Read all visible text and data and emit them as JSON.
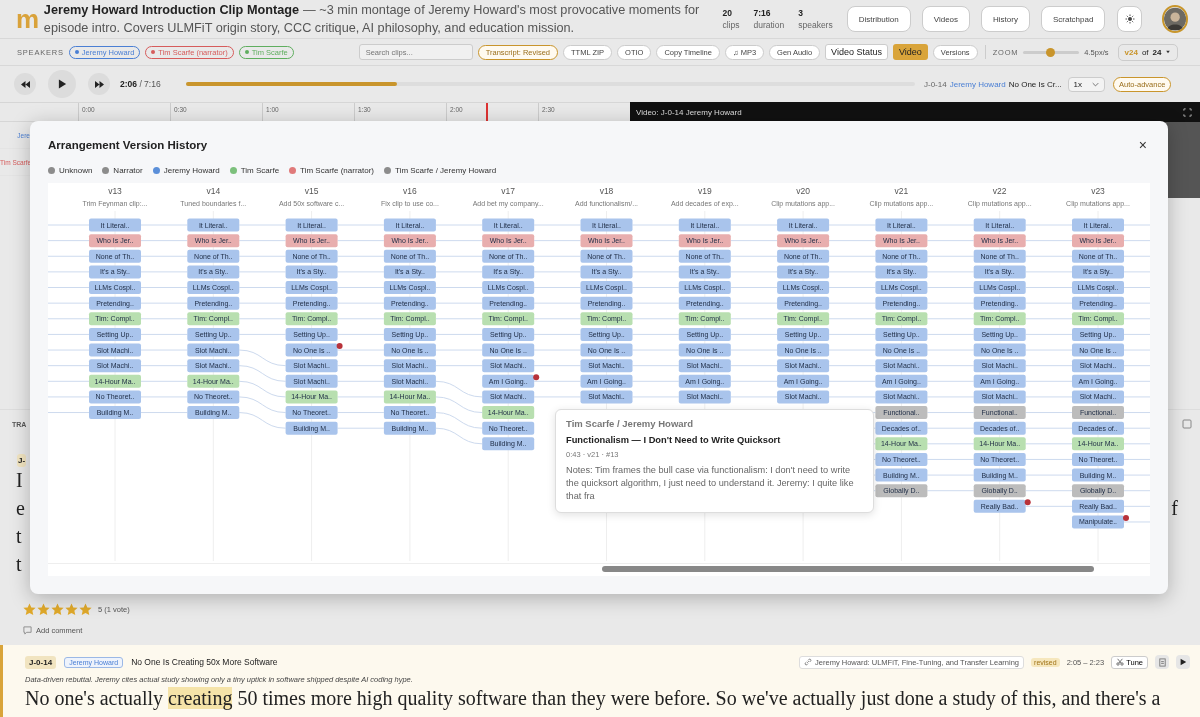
{
  "header": {
    "logo": "m",
    "title": "Jeremy Howard Introduction Clip Montage",
    "description": "— ~3 min montage of Jeremy Howard's most provocative moments for episode intro. Covers ULMFiT origin story, CCC critique, AI philosophy, and education mission.",
    "stats": [
      {
        "value": "20",
        "label": "clips"
      },
      {
        "value": "7:16",
        "label": "duration"
      },
      {
        "value": "3",
        "label": "speakers"
      }
    ],
    "buttons": [
      "Distribution",
      "Videos",
      "History",
      "Scratchpad"
    ]
  },
  "toolbar": {
    "speakers_label": "SPEAKERS",
    "speakers": [
      {
        "name": "Jeremy Howard",
        "color": "#4a7fd4"
      },
      {
        "name": "Tim Scarfe (narrator)",
        "color": "#d65c5c"
      },
      {
        "name": "Tim Scarfe",
        "color": "#5fae5f"
      }
    ],
    "search": {
      "placeholder": "Search clips..."
    },
    "actions": [
      {
        "label": "Transcript: Revised",
        "kind": "status"
      },
      {
        "label": "TTML ZIP",
        "kind": "pill"
      },
      {
        "label": "OTIO",
        "kind": "pill"
      },
      {
        "label": "Copy Timeline",
        "kind": "pill"
      },
      {
        "label": "♫ MP3",
        "kind": "pill"
      },
      {
        "label": "Gen Audio",
        "kind": "pill"
      },
      {
        "label": "Video Status",
        "kind": "box"
      },
      {
        "label": "Video",
        "kind": "toggle",
        "on": true
      },
      {
        "label": "Versions",
        "kind": "pill"
      }
    ],
    "zoom": {
      "label": "ZOOM",
      "level": 0.48,
      "reading": "4.5px/s"
    },
    "version_select": {
      "current": "v24",
      "of": "of",
      "total": "24"
    }
  },
  "player": {
    "elapsed": "2:06",
    "total": "/ 7:16",
    "progress": {
      "level": 0.29
    },
    "clip_id": "J-0-14",
    "speaker": "Jeremy Howard",
    "clip_title": "No One Is Cr...",
    "speed": "1x",
    "auto_advance": "Auto-advance"
  },
  "timeline": {
    "ticks": [
      "0:00",
      "0:30",
      "1:00",
      "1:30",
      "2:00",
      "2:30"
    ],
    "lanes": [
      {
        "label": "Jere",
        "kind": "jeremy"
      },
      {
        "label": "Tim Scarfe",
        "kind": "narrator"
      }
    ]
  },
  "video": {
    "title": "Video: J-0-14 Jeremy Howard"
  },
  "transcript": {
    "section_label": "TRA",
    "badge": "J-",
    "lines": [
      {
        "start": "I"
      },
      {
        "start": "e",
        "end": "f"
      },
      {
        "start": "t"
      },
      {
        "start": "t"
      }
    ]
  },
  "rating": {
    "stars": 5,
    "count": "5 (1 vote)"
  },
  "add_comment": "Add comment",
  "clip_card": {
    "id": "J-0-14",
    "speaker": "Jeremy Howard",
    "title": "No One Is Creating 50x More Software",
    "source": "Jeremy Howard: ULMFiT, Fine-Tuning, and Transfer Learning",
    "status": "revised",
    "range": "2:05 – 2:23",
    "tune": "Tune",
    "note": "Data-driven rebuttal. Jeremy cites actual study showing only a tiny uptick in software shipped despite AI coding hype.",
    "text": [
      {
        "text": "No one's actually ",
        "highlighted": false
      },
      {
        "text": "creating",
        "highlighted": true
      },
      {
        "text": " 50 times more high quality software than they were before. So we've actually just done a study of this, and there's a",
        "highlighted": false
      }
    ]
  },
  "modal": {
    "title": "Arrangement Version History",
    "close": "×",
    "legend": [
      {
        "label": "Unknown",
        "color": "#8c8c8c"
      },
      {
        "label": "Narrator",
        "color": "#8c8c8c"
      },
      {
        "label": "Jeremy Howard",
        "color": "#5b8fd9"
      },
      {
        "label": "Tim Scarfe",
        "color": "#7cc07c"
      },
      {
        "label": "Tim Scarfe (narrator)",
        "color": "#e07a7a"
      },
      {
        "label": "Tim Scarfe / Jeremy Howard",
        "color": "#8c8c8c"
      }
    ],
    "columns": [
      {
        "version": "v13",
        "summary": "Trim Feynman clip:...",
        "clips": [
          {
            "label": "It Literal..",
            "color": "#a9c4ec",
            "added": false
          },
          {
            "label": "Who Is Jer..",
            "color": "#e8aeae",
            "added": false
          },
          {
            "label": "None of Th..",
            "color": "#a9c4ec",
            "added": false
          },
          {
            "label": "It's a Sty..",
            "color": "#a9c4ec",
            "added": false
          },
          {
            "label": "LLMs Cospl..",
            "color": "#a9c4ec",
            "added": false
          },
          {
            "label": "Pretending..",
            "color": "#a9c4ec",
            "added": false
          },
          {
            "label": "Tim: Compl..",
            "color": "#b8dfb0",
            "added": false
          },
          {
            "label": "Setting Up..",
            "color": "#a9c4ec",
            "added": false
          },
          {
            "label": "Slot Machi..",
            "color": "#a9c4ec",
            "added": false
          },
          {
            "label": "Slot Machi..",
            "color": "#a9c4ec",
            "added": false
          },
          {
            "label": "14-Hour Ma..",
            "color": "#b8dfb0",
            "added": false
          },
          {
            "label": "No Theoret..",
            "color": "#a9c4ec",
            "added": false
          },
          {
            "label": "Building M..",
            "color": "#a9c4ec",
            "added": false
          }
        ]
      },
      {
        "version": "v14",
        "summary": "Tuned boundaries f...",
        "clips": [
          {
            "label": "It Literal..",
            "color": "#a9c4ec",
            "added": false
          },
          {
            "label": "Who Is Jer..",
            "color": "#e8aeae",
            "added": false
          },
          {
            "label": "None of Th..",
            "color": "#a9c4ec",
            "added": false
          },
          {
            "label": "It's a Sty..",
            "color": "#a9c4ec",
            "added": false
          },
          {
            "label": "LLMs Cospl..",
            "color": "#a9c4ec",
            "added": false
          },
          {
            "label": "Pretending..",
            "color": "#a9c4ec",
            "added": false
          },
          {
            "label": "Tim: Compl..",
            "color": "#b8dfb0",
            "added": false
          },
          {
            "label": "Setting Up..",
            "color": "#a9c4ec",
            "added": false
          },
          {
            "label": "Slot Machi..",
            "color": "#a9c4ec",
            "added": false
          },
          {
            "label": "Slot Machi..",
            "color": "#a9c4ec",
            "added": false
          },
          {
            "label": "14-Hour Ma..",
            "color": "#b8dfb0",
            "added": false
          },
          {
            "label": "No Theoret..",
            "color": "#a9c4ec",
            "added": false
          },
          {
            "label": "Building M..",
            "color": "#a9c4ec",
            "added": false
          }
        ]
      },
      {
        "version": "v15",
        "summary": "Add 50x software c...",
        "clips": [
          {
            "label": "It Literal..",
            "color": "#a9c4ec",
            "added": false
          },
          {
            "label": "Who Is Jer..",
            "color": "#e8aeae",
            "added": false
          },
          {
            "label": "None of Th..",
            "color": "#a9c4ec",
            "added": false
          },
          {
            "label": "It's a Sty..",
            "color": "#a9c4ec",
            "added": false
          },
          {
            "label": "LLMs Cospl..",
            "color": "#a9c4ec",
            "added": false
          },
          {
            "label": "Pretending..",
            "color": "#a9c4ec",
            "added": false
          },
          {
            "label": "Tim: Compl..",
            "color": "#b8dfb0",
            "added": false
          },
          {
            "label": "Setting Up..",
            "color": "#a9c4ec",
            "added": false
          },
          {
            "label": "No One Is ..",
            "color": "#a9c4ec",
            "added": true
          },
          {
            "label": "Slot Machi..",
            "color": "#a9c4ec",
            "added": false
          },
          {
            "label": "Slot Machi..",
            "color": "#a9c4ec",
            "added": false
          },
          {
            "label": "14-Hour Ma..",
            "color": "#b8dfb0",
            "added": false
          },
          {
            "label": "No Theoret..",
            "color": "#a9c4ec",
            "added": false
          },
          {
            "label": "Building M..",
            "color": "#a9c4ec",
            "added": false
          }
        ]
      },
      {
        "version": "v16",
        "summary": "Fix clip to use co...",
        "clips": [
          {
            "label": "It Literal..",
            "color": "#a9c4ec",
            "added": false
          },
          {
            "label": "Who Is Jer..",
            "color": "#e8aeae",
            "added": false
          },
          {
            "label": "None of Th..",
            "color": "#a9c4ec",
            "added": false
          },
          {
            "label": "It's a Sty..",
            "color": "#a9c4ec",
            "added": false
          },
          {
            "label": "LLMs Cospl..",
            "color": "#a9c4ec",
            "added": false
          },
          {
            "label": "Pretending..",
            "color": "#a9c4ec",
            "added": false
          },
          {
            "label": "Tim: Compl..",
            "color": "#b8dfb0",
            "added": false
          },
          {
            "label": "Setting Up..",
            "color": "#a9c4ec",
            "added": false
          },
          {
            "label": "No One Is ..",
            "color": "#a9c4ec",
            "added": false
          },
          {
            "label": "Slot Machi..",
            "color": "#a9c4ec",
            "added": false
          },
          {
            "label": "Slot Machi..",
            "color": "#a9c4ec",
            "added": false
          },
          {
            "label": "14-Hour Ma..",
            "color": "#b8dfb0",
            "added": false
          },
          {
            "label": "No Theoret..",
            "color": "#a9c4ec",
            "added": false
          },
          {
            "label": "Building M..",
            "color": "#a9c4ec",
            "added": false
          }
        ]
      },
      {
        "version": "v17",
        "summary": "Add bet my company...",
        "clips": [
          {
            "label": "It Literal..",
            "color": "#a9c4ec",
            "added": false
          },
          {
            "label": "Who Is Jer..",
            "color": "#e8aeae",
            "added": false
          },
          {
            "label": "None of Th..",
            "color": "#a9c4ec",
            "added": false
          },
          {
            "label": "It's a Sty..",
            "color": "#a9c4ec",
            "added": false
          },
          {
            "label": "LLMs Cospl..",
            "color": "#a9c4ec",
            "added": false
          },
          {
            "label": "Pretending..",
            "color": "#a9c4ec",
            "added": false
          },
          {
            "label": "Tim: Compl..",
            "color": "#b8dfb0",
            "added": false
          },
          {
            "label": "Setting Up..",
            "color": "#a9c4ec",
            "added": false
          },
          {
            "label": "No One Is ..",
            "color": "#a9c4ec",
            "added": false
          },
          {
            "label": "Slot Machi..",
            "color": "#a9c4ec",
            "added": false
          },
          {
            "label": "Am I Going..",
            "color": "#a9c4ec",
            "added": true
          },
          {
            "label": "Slot Machi..",
            "color": "#a9c4ec",
            "added": false
          },
          {
            "label": "14-Hour Ma..",
            "color": "#b8dfb0",
            "added": false
          },
          {
            "label": "No Theoret..",
            "color": "#a9c4ec",
            "added": false
          },
          {
            "label": "Building M..",
            "color": "#a9c4ec",
            "added": false
          }
        ]
      },
      {
        "version": "v18",
        "summary": "Add functionalism/...",
        "clips": [
          {
            "label": "It Literal..",
            "color": "#a9c4ec",
            "added": false
          },
          {
            "label": "Who Is Jer..",
            "color": "#e8aeae",
            "added": false
          },
          {
            "label": "None of Th..",
            "color": "#a9c4ec",
            "added": false
          },
          {
            "label": "It's a Sty..",
            "color": "#a9c4ec",
            "added": false
          },
          {
            "label": "LLMs Cospl..",
            "color": "#a9c4ec",
            "added": false
          },
          {
            "label": "Pretending..",
            "color": "#a9c4ec",
            "added": false
          },
          {
            "label": "Tim: Compl..",
            "color": "#b8dfb0",
            "added": false
          },
          {
            "label": "Setting Up..",
            "color": "#a9c4ec",
            "added": false
          },
          {
            "label": "No One Is ..",
            "color": "#a9c4ec",
            "added": false
          },
          {
            "label": "Slot Machi..",
            "color": "#a9c4ec",
            "added": false
          },
          {
            "label": "Am I Going..",
            "color": "#a9c4ec",
            "added": false
          },
          {
            "label": "Slot Machi..",
            "color": "#a9c4ec",
            "added": false
          }
        ]
      },
      {
        "version": "v19",
        "summary": "Add decades of exp...",
        "clips": [
          {
            "label": "It Literal..",
            "color": "#a9c4ec",
            "added": false
          },
          {
            "label": "Who Is Jer..",
            "color": "#e8aeae",
            "added": false
          },
          {
            "label": "None of Th..",
            "color": "#a9c4ec",
            "added": false
          },
          {
            "label": "It's a Sty..",
            "color": "#a9c4ec",
            "added": false
          },
          {
            "label": "LLMs Cospl..",
            "color": "#a9c4ec",
            "added": false
          },
          {
            "label": "Pretending..",
            "color": "#a9c4ec",
            "added": false
          },
          {
            "label": "Tim: Compl..",
            "color": "#b8dfb0",
            "added": false
          },
          {
            "label": "Setting Up..",
            "color": "#a9c4ec",
            "added": false
          },
          {
            "label": "No One Is ..",
            "color": "#a9c4ec",
            "added": false
          },
          {
            "label": "Slot Machi..",
            "color": "#a9c4ec",
            "added": false
          },
          {
            "label": "Am I Going..",
            "color": "#a9c4ec",
            "added": false
          },
          {
            "label": "Slot Machi..",
            "color": "#a9c4ec",
            "added": false
          }
        ]
      },
      {
        "version": "v20",
        "summary": "Clip mutations app...",
        "clips": [
          {
            "label": "It Literal..",
            "color": "#a9c4ec",
            "added": false
          },
          {
            "label": "Who Is Jer..",
            "color": "#e8aeae",
            "added": false
          },
          {
            "label": "None of Th..",
            "color": "#a9c4ec",
            "added": false
          },
          {
            "label": "It's a Sty..",
            "color": "#a9c4ec",
            "added": false
          },
          {
            "label": "LLMs Cospl..",
            "color": "#a9c4ec",
            "added": false
          },
          {
            "label": "Pretending..",
            "color": "#a9c4ec",
            "added": false
          },
          {
            "label": "Tim: Compl..",
            "color": "#b8dfb0",
            "added": false
          },
          {
            "label": "Setting Up..",
            "color": "#a9c4ec",
            "added": false
          },
          {
            "label": "No One Is ..",
            "color": "#a9c4ec",
            "added": false
          },
          {
            "label": "Slot Machi..",
            "color": "#a9c4ec",
            "added": false
          },
          {
            "label": "Am I Going..",
            "color": "#a9c4ec",
            "added": false
          },
          {
            "label": "Slot Machi..",
            "color": "#a9c4ec",
            "added": false
          }
        ]
      },
      {
        "version": "v21",
        "summary": "Clip mutations app...",
        "clips": [
          {
            "label": "It Literal..",
            "color": "#a9c4ec",
            "added": false
          },
          {
            "label": "Who Is Jer..",
            "color": "#e8aeae",
            "added": false
          },
          {
            "label": "None of Th..",
            "color": "#a9c4ec",
            "added": false
          },
          {
            "label": "It's a Sty..",
            "color": "#a9c4ec",
            "added": false
          },
          {
            "label": "LLMs Cospl..",
            "color": "#a9c4ec",
            "added": false
          },
          {
            "label": "Pretending..",
            "color": "#a9c4ec",
            "added": false
          },
          {
            "label": "Tim: Compl..",
            "color": "#b8dfb0",
            "added": false
          },
          {
            "label": "Setting Up..",
            "color": "#a9c4ec",
            "added": false
          },
          {
            "label": "No One Is ..",
            "color": "#a9c4ec",
            "added": false
          },
          {
            "label": "Slot Machi..",
            "color": "#a9c4ec",
            "added": false
          },
          {
            "label": "Am I Going..",
            "color": "#a9c4ec",
            "added": false
          },
          {
            "label": "Slot Machi..",
            "color": "#a9c4ec",
            "added": false
          },
          {
            "label": "Functional..",
            "color": "#bcbcbc",
            "added": false
          },
          {
            "label": "Decades of..",
            "color": "#a9c4ec",
            "added": false
          },
          {
            "label": "14-Hour Ma..",
            "color": "#b8dfb0",
            "added": false
          },
          {
            "label": "No Theoret..",
            "color": "#a9c4ec",
            "added": false
          },
          {
            "label": "Building M..",
            "color": "#a9c4ec",
            "added": false
          },
          {
            "label": "Globally D..",
            "color": "#bcbcbc",
            "added": false
          }
        ]
      },
      {
        "version": "v22",
        "summary": "Clip mutations app...",
        "clips": [
          {
            "label": "It Literal..",
            "color": "#a9c4ec",
            "added": false
          },
          {
            "label": "Who Is Jer..",
            "color": "#e8aeae",
            "added": false
          },
          {
            "label": "None of Th..",
            "color": "#a9c4ec",
            "added": false
          },
          {
            "label": "It's a Sty..",
            "color": "#a9c4ec",
            "added": false
          },
          {
            "label": "LLMs Cospl..",
            "color": "#a9c4ec",
            "added": false
          },
          {
            "label": "Pretending..",
            "color": "#a9c4ec",
            "added": false
          },
          {
            "label": "Tim: Compl..",
            "color": "#b8dfb0",
            "added": false
          },
          {
            "label": "Setting Up..",
            "color": "#a9c4ec",
            "added": false
          },
          {
            "label": "No One Is ..",
            "color": "#a9c4ec",
            "added": false
          },
          {
            "label": "Slot Machi..",
            "color": "#a9c4ec",
            "added": false
          },
          {
            "label": "Am I Going..",
            "color": "#a9c4ec",
            "added": false
          },
          {
            "label": "Slot Machi..",
            "color": "#a9c4ec",
            "added": false
          },
          {
            "label": "Functional..",
            "color": "#bcbcbc",
            "added": false
          },
          {
            "label": "Decades of..",
            "color": "#a9c4ec",
            "added": false
          },
          {
            "label": "14-Hour Ma..",
            "color": "#b8dfb0",
            "added": false
          },
          {
            "label": "No Theoret..",
            "color": "#a9c4ec",
            "added": false
          },
          {
            "label": "Building M..",
            "color": "#a9c4ec",
            "added": false
          },
          {
            "label": "Globally D..",
            "color": "#bcbcbc",
            "added": false
          },
          {
            "label": "Really Bad..",
            "color": "#a9c4ec",
            "added": true
          }
        ]
      },
      {
        "version": "v23",
        "summary": "Clip mutations app...",
        "clips": [
          {
            "label": "It Literal..",
            "color": "#a9c4ec",
            "added": false
          },
          {
            "label": "Who Is Jer..",
            "color": "#e8aeae",
            "added": false
          },
          {
            "label": "None of Th..",
            "color": "#a9c4ec",
            "added": false
          },
          {
            "label": "It's a Sty..",
            "color": "#a9c4ec",
            "added": false
          },
          {
            "label": "LLMs Cospl..",
            "color": "#a9c4ec",
            "added": false
          },
          {
            "label": "Pretending..",
            "color": "#a9c4ec",
            "added": false
          },
          {
            "label": "Tim: Compl..",
            "color": "#b8dfb0",
            "added": false
          },
          {
            "label": "Setting Up..",
            "color": "#a9c4ec",
            "added": false
          },
          {
            "label": "No One Is ..",
            "color": "#a9c4ec",
            "added": false
          },
          {
            "label": "Slot Machi..",
            "color": "#a9c4ec",
            "added": false
          },
          {
            "label": "Am I Going..",
            "color": "#a9c4ec",
            "added": false
          },
          {
            "label": "Slot Machi..",
            "color": "#a9c4ec",
            "added": false
          },
          {
            "label": "Functional..",
            "color": "#bcbcbc",
            "added": false
          },
          {
            "label": "Decades of..",
            "color": "#a9c4ec",
            "added": false
          },
          {
            "label": "14-Hour Ma..",
            "color": "#b8dfb0",
            "added": false
          },
          {
            "label": "No Theoret..",
            "color": "#a9c4ec",
            "added": false
          },
          {
            "label": "Building M..",
            "color": "#a9c4ec",
            "added": false
          },
          {
            "label": "Globally D..",
            "color": "#bcbcbc",
            "added": false
          },
          {
            "label": "Really Bad..",
            "color": "#a9c4ec",
            "added": false
          },
          {
            "label": "Manipulate..",
            "color": "#a9c4ec",
            "added": true
          }
        ]
      }
    ],
    "tooltip": {
      "speaker": "Tim Scarfe / Jeremy Howard",
      "title": "Functionalism — I Don't Need to Write Quicksort",
      "meta": "0:43 · v21 · #13",
      "notes": "Notes: Tim frames the bull case via functionalism: I don't need to write the quicksort algorithm, I just need to understand it. Jeremy: I quite like that fra"
    }
  }
}
